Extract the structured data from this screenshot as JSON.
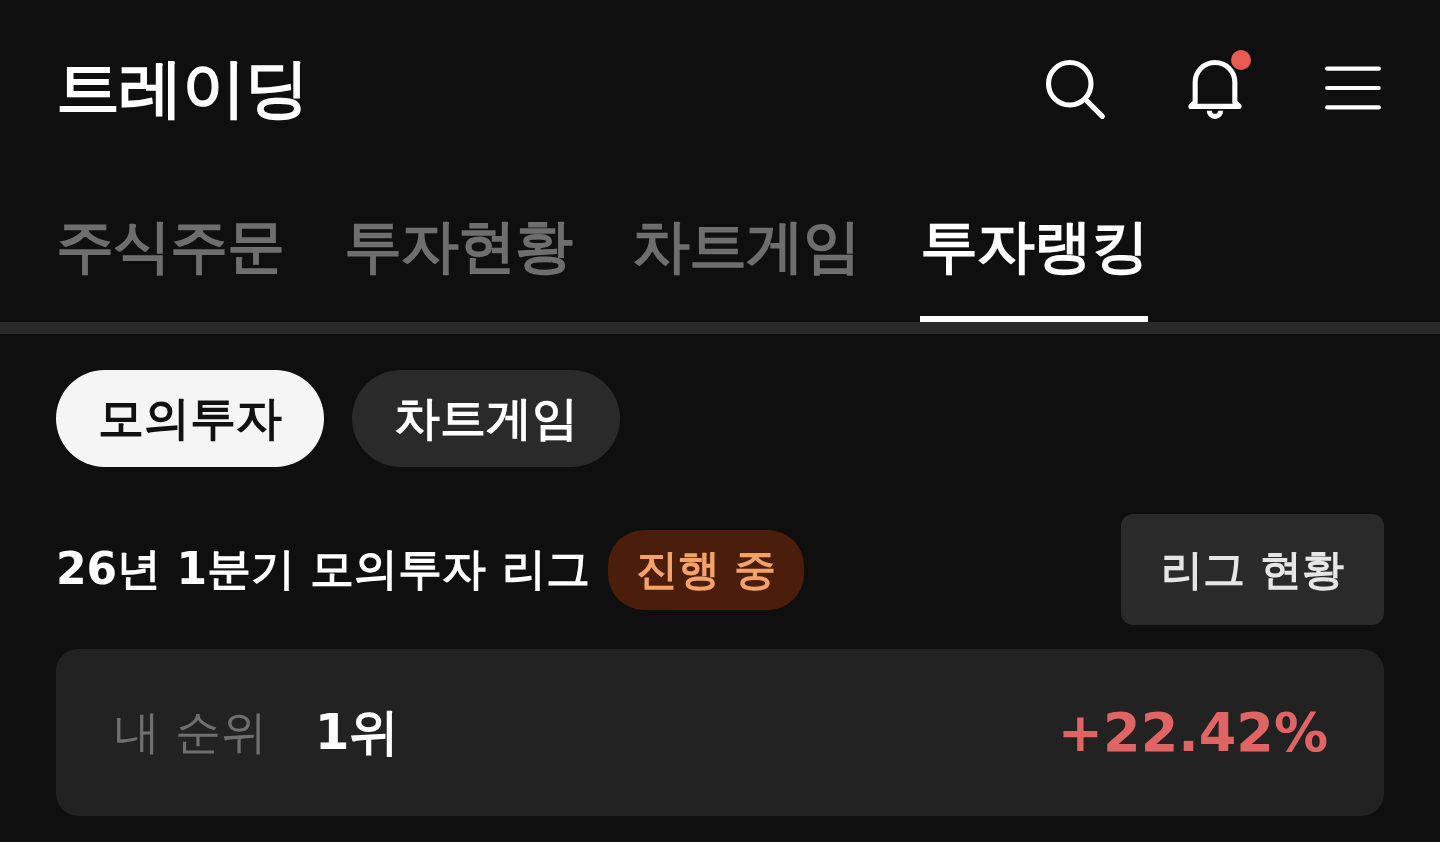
{
  "header": {
    "title": "트레이딩",
    "notification_unread": true
  },
  "tabs": [
    {
      "label": "주식주문",
      "selected": false
    },
    {
      "label": "투자현황",
      "selected": false
    },
    {
      "label": "차트게임",
      "selected": false
    },
    {
      "label": "투자랭킹",
      "selected": true
    }
  ],
  "filters": [
    {
      "label": "모의투자",
      "selected": true
    },
    {
      "label": "차트게임",
      "selected": false
    }
  ],
  "league": {
    "title": "26년 1분기 모의투자 리그",
    "status": "진행 중",
    "button": "리그 현황"
  },
  "my_rank": {
    "label": "내 순위",
    "rank": "1위",
    "return": "+22.42%"
  }
}
